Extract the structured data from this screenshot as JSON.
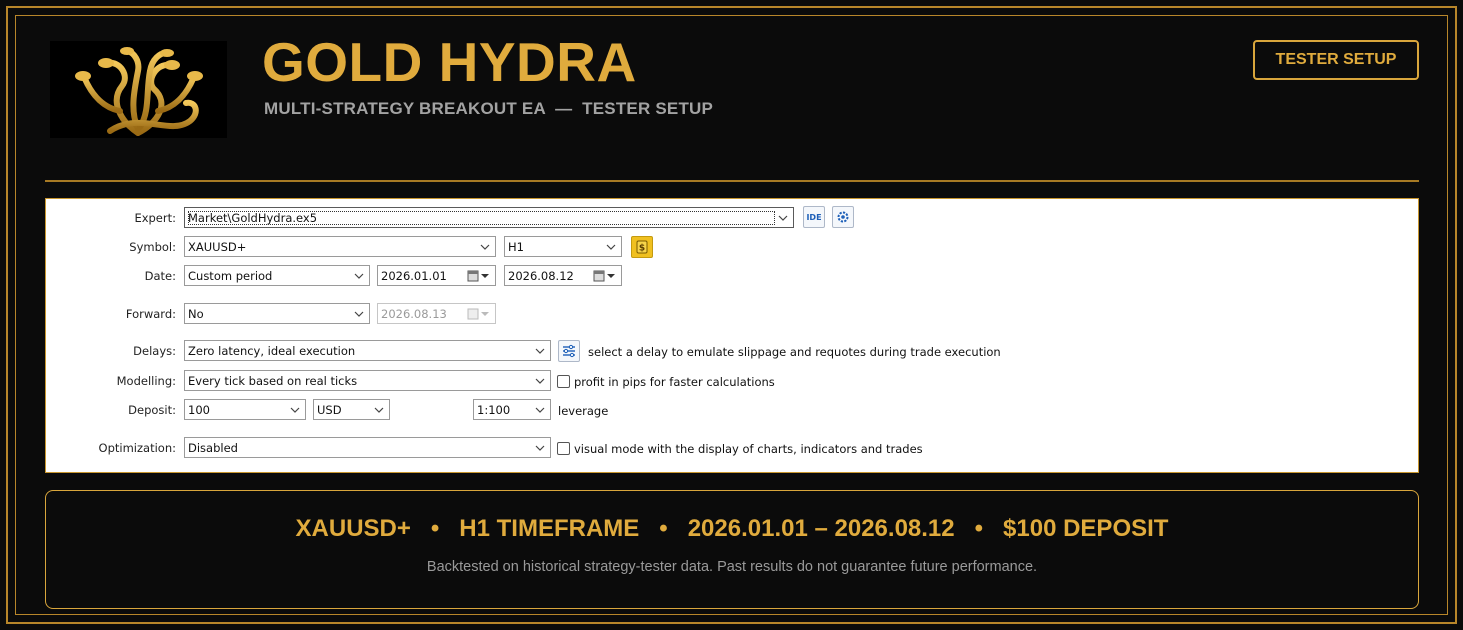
{
  "header": {
    "title": "GOLD HYDRA",
    "subtitle": "MULTI-STRATEGY BREAKOUT EA  —  TESTER SETUP",
    "tester_button": "TESTER SETUP"
  },
  "settings": {
    "expert": {
      "label": "Expert:",
      "value": "Market\\GoldHydra.ex5"
    },
    "symbol": {
      "label": "Symbol:",
      "value": "XAUUSD+",
      "timeframe": "H1"
    },
    "date": {
      "label": "Date:",
      "value": "Custom period",
      "from": "2026.01.01",
      "to": "2026.08.12"
    },
    "forward": {
      "label": "Forward:",
      "value": "No",
      "date": "2026.08.13"
    },
    "delays": {
      "label": "Delays:",
      "value": "Zero latency, ideal execution",
      "note": "select a delay to emulate slippage and requotes during trade execution"
    },
    "modelling": {
      "label": "Modelling:",
      "value": "Every tick based on real ticks",
      "checkbox_label": "profit in pips for faster calculations"
    },
    "deposit": {
      "label": "Deposit:",
      "value": "100",
      "currency": "USD",
      "leverage_value": "1:100",
      "leverage_label": "leverage"
    },
    "optimization": {
      "label": "Optimization:",
      "value": "Disabled",
      "checkbox_label": "visual mode with the display of charts, indicators and trades"
    },
    "ide_button": "IDE"
  },
  "summary": {
    "symbol": "XAUUSD+",
    "timeframe": "H1 TIMEFRAME",
    "period": "2026.01.01 – 2026.08.12",
    "deposit": "$100 DEPOSIT",
    "separator": "•",
    "disclaimer": "Backtested on historical strategy-tester data. Past results do not guarantee future performance."
  },
  "colors": {
    "gold": "#e0ab3d",
    "border": "#b8862a",
    "background": "#0b0b0b"
  }
}
